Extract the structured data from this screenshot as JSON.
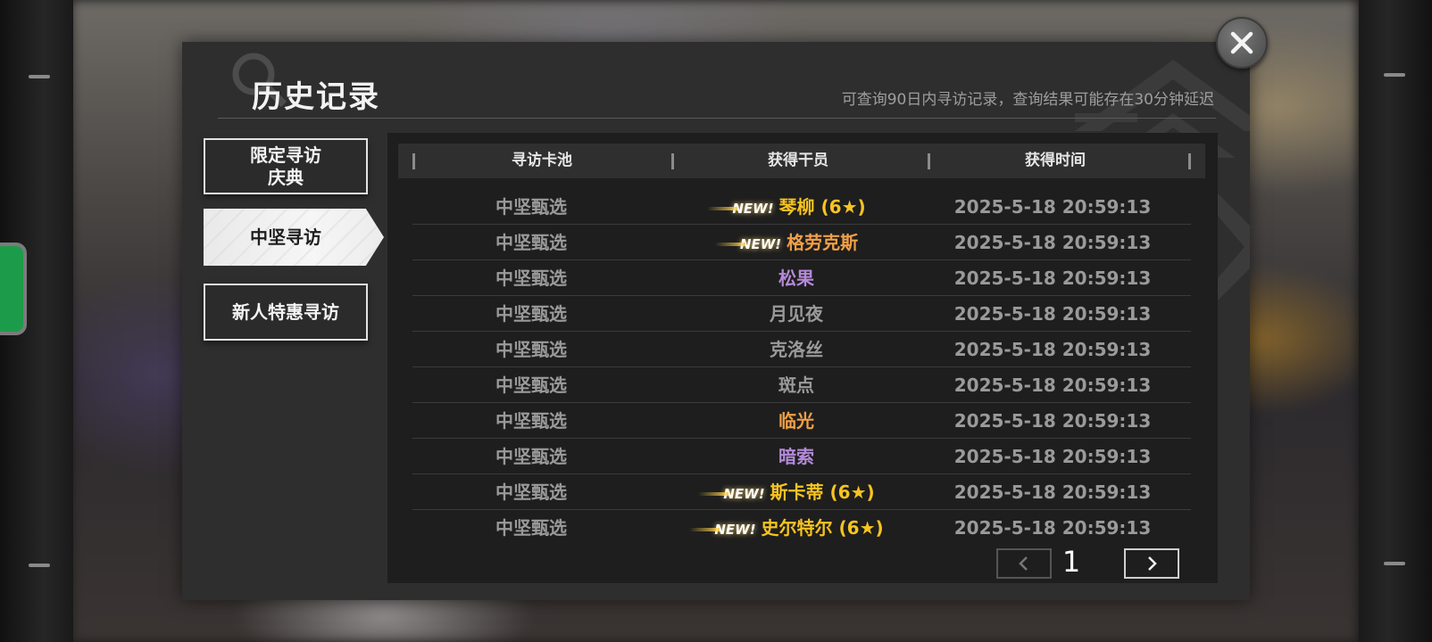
{
  "modal": {
    "title": "历史记录",
    "subtitle": "可查询90日内寻访记录，查询结果可能存在30分钟延迟"
  },
  "tabs": [
    {
      "line1": "限定寻访",
      "line2": "庆典",
      "active": false
    },
    {
      "line1": "中坚寻访",
      "line2": "",
      "active": true
    },
    {
      "line1": "新人特惠寻访",
      "line2": "",
      "active": false
    }
  ],
  "table": {
    "headers": [
      "寻访卡池",
      "获得干员",
      "获得时间"
    ],
    "rows": [
      {
        "pool": "中坚甄选",
        "new_badge": "NEW!",
        "operator": "琴柳 (6★)",
        "color": "#f6c421",
        "time": "2025-5-18 20:59:13"
      },
      {
        "pool": "中坚甄选",
        "new_badge": "NEW!",
        "operator": "格劳克斯",
        "color": "#f0a048",
        "time": "2025-5-18 20:59:13"
      },
      {
        "pool": "中坚甄选",
        "new_badge": "",
        "operator": "松果",
        "color": "#b48ad8",
        "time": "2025-5-18 20:59:13"
      },
      {
        "pool": "中坚甄选",
        "new_badge": "",
        "operator": "月见夜",
        "color": "#9a9a9a",
        "time": "2025-5-18 20:59:13"
      },
      {
        "pool": "中坚甄选",
        "new_badge": "",
        "operator": "克洛丝",
        "color": "#9a9a9a",
        "time": "2025-5-18 20:59:13"
      },
      {
        "pool": "中坚甄选",
        "new_badge": "",
        "operator": "斑点",
        "color": "#9a9a9a",
        "time": "2025-5-18 20:59:13"
      },
      {
        "pool": "中坚甄选",
        "new_badge": "",
        "operator": "临光",
        "color": "#f0a048",
        "time": "2025-5-18 20:59:13"
      },
      {
        "pool": "中坚甄选",
        "new_badge": "",
        "operator": "暗索",
        "color": "#b48ad8",
        "time": "2025-5-18 20:59:13"
      },
      {
        "pool": "中坚甄选",
        "new_badge": "NEW!",
        "operator": "斯卡蒂 (6★)",
        "color": "#f6c421",
        "time": "2025-5-18 20:59:13"
      },
      {
        "pool": "中坚甄选",
        "new_badge": "NEW!",
        "operator": "史尔特尔 (6★)",
        "color": "#f6c421",
        "time": "2025-5-18 20:59:13"
      }
    ]
  },
  "pager": {
    "current_page": "1",
    "prev_icon": "chevron-left-icon",
    "next_icon": "chevron-right-icon"
  },
  "close_icon": "close-icon",
  "colors": {
    "six_star": "#f6c421",
    "five_star": "#f0a048",
    "four_star": "#b48ad8",
    "three_star": "#9a9a9a",
    "badge_green": "#1c9c4a"
  }
}
